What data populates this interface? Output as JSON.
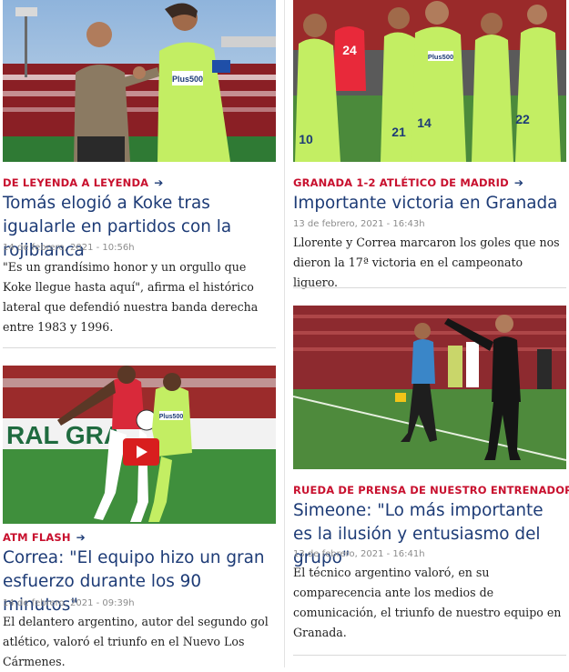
{
  "articles": [
    {
      "category": "DE LEYENDA A LEYENDA",
      "title": "Tomás elogió a Koke tras igualarle en partidos con la rojiblanca",
      "date": "14 de febrero, 2021 - 10:56h",
      "excerpt": "\"Es un grandísimo honor y un orgullo que Koke llegue hasta aquí\", afirma el histórico lateral que defendió nuestra banda derecha entre 1983 y 1996.",
      "jersey_sponsor": "Plus500"
    },
    {
      "category": "GRANADA 1-2 ATLÉTICO DE MADRID",
      "title": "Importante victoria en Granada",
      "date": "13 de febrero, 2021 - 16:43h",
      "excerpt": "Llorente y Correa marcaron los goles que nos dieron la 17ª victoria en el campeonato liguero.",
      "jersey_sponsor": "Plus500",
      "jersey_numbers": [
        "24",
        "10",
        "21",
        "14",
        "22"
      ]
    },
    {
      "category": "ATM FLASH",
      "title": "Correa: \"El equipo hizo un gran esfuerzo durante los 90 minutos\"",
      "date": "14 de febrero, 2021 - 09:39h",
      "excerpt": "El delantero argentino, autor del segundo gol atlético, valoró el triunfo en el Nuevo Los Cármenes.",
      "jersey_sponsor": "Plus500",
      "board_text": "RAL GRA"
    },
    {
      "category": "RUEDA DE PRENSA DE NUESTRO ENTRENADOR",
      "title": "Simeone: \"Lo más importante es la ilusión y entusiasmo del grupo\"",
      "date": "13 de febrero, 2021 - 16:41h",
      "excerpt": "El técnico argentino valoró, en su comparecencia ante los medios de comunicación, el triunfo de nuestro equipo en Granada."
    }
  ],
  "colors": {
    "category": "#c8102e",
    "title": "#1d3b76",
    "date": "#8c8c8c",
    "body": "#222222"
  }
}
